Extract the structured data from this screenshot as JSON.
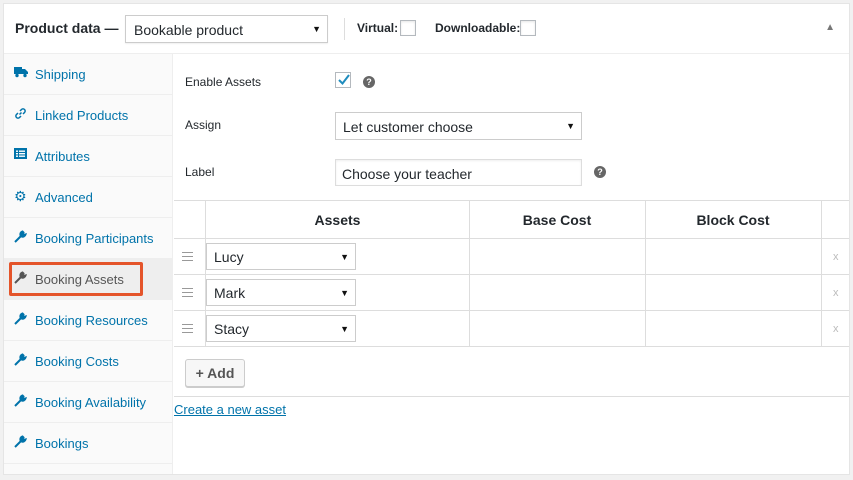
{
  "header": {
    "title": "Product data —",
    "product_type": "Bookable product",
    "virtual_label": "Virtual:",
    "downloadable_label": "Downloadable:"
  },
  "sidebar": {
    "items": [
      {
        "label": "Shipping",
        "icon": "truck-icon"
      },
      {
        "label": "Linked Products",
        "icon": "link-icon"
      },
      {
        "label": "Attributes",
        "icon": "list-icon"
      },
      {
        "label": "Advanced",
        "icon": "gear-icon"
      },
      {
        "label": "Booking Participants",
        "icon": "wrench-icon"
      },
      {
        "label": "Booking Assets",
        "icon": "wrench-icon",
        "active": true
      },
      {
        "label": "Booking Resources",
        "icon": "wrench-icon"
      },
      {
        "label": "Booking Costs",
        "icon": "wrench-icon"
      },
      {
        "label": "Booking Availability",
        "icon": "wrench-icon"
      },
      {
        "label": "Bookings",
        "icon": "wrench-icon"
      }
    ]
  },
  "form": {
    "enable_label": "Enable Assets",
    "enabled": true,
    "assign_label": "Assign",
    "assign_value": "Let customer choose",
    "label_label": "Label",
    "label_value": "Choose your teacher",
    "help": "?"
  },
  "table": {
    "headers": [
      "Assets",
      "Base Cost",
      "Block Cost"
    ],
    "rows": [
      {
        "asset": "Lucy",
        "base_cost": "",
        "block_cost": ""
      },
      {
        "asset": "Mark",
        "base_cost": "",
        "block_cost": ""
      },
      {
        "asset": "Stacy",
        "base_cost": "",
        "block_cost": ""
      }
    ],
    "remove_label": "x",
    "add_label": "+ Add"
  },
  "create_link": "Create a new asset",
  "colors": {
    "accent": "#0073aa",
    "highlight": "#e4542a"
  }
}
